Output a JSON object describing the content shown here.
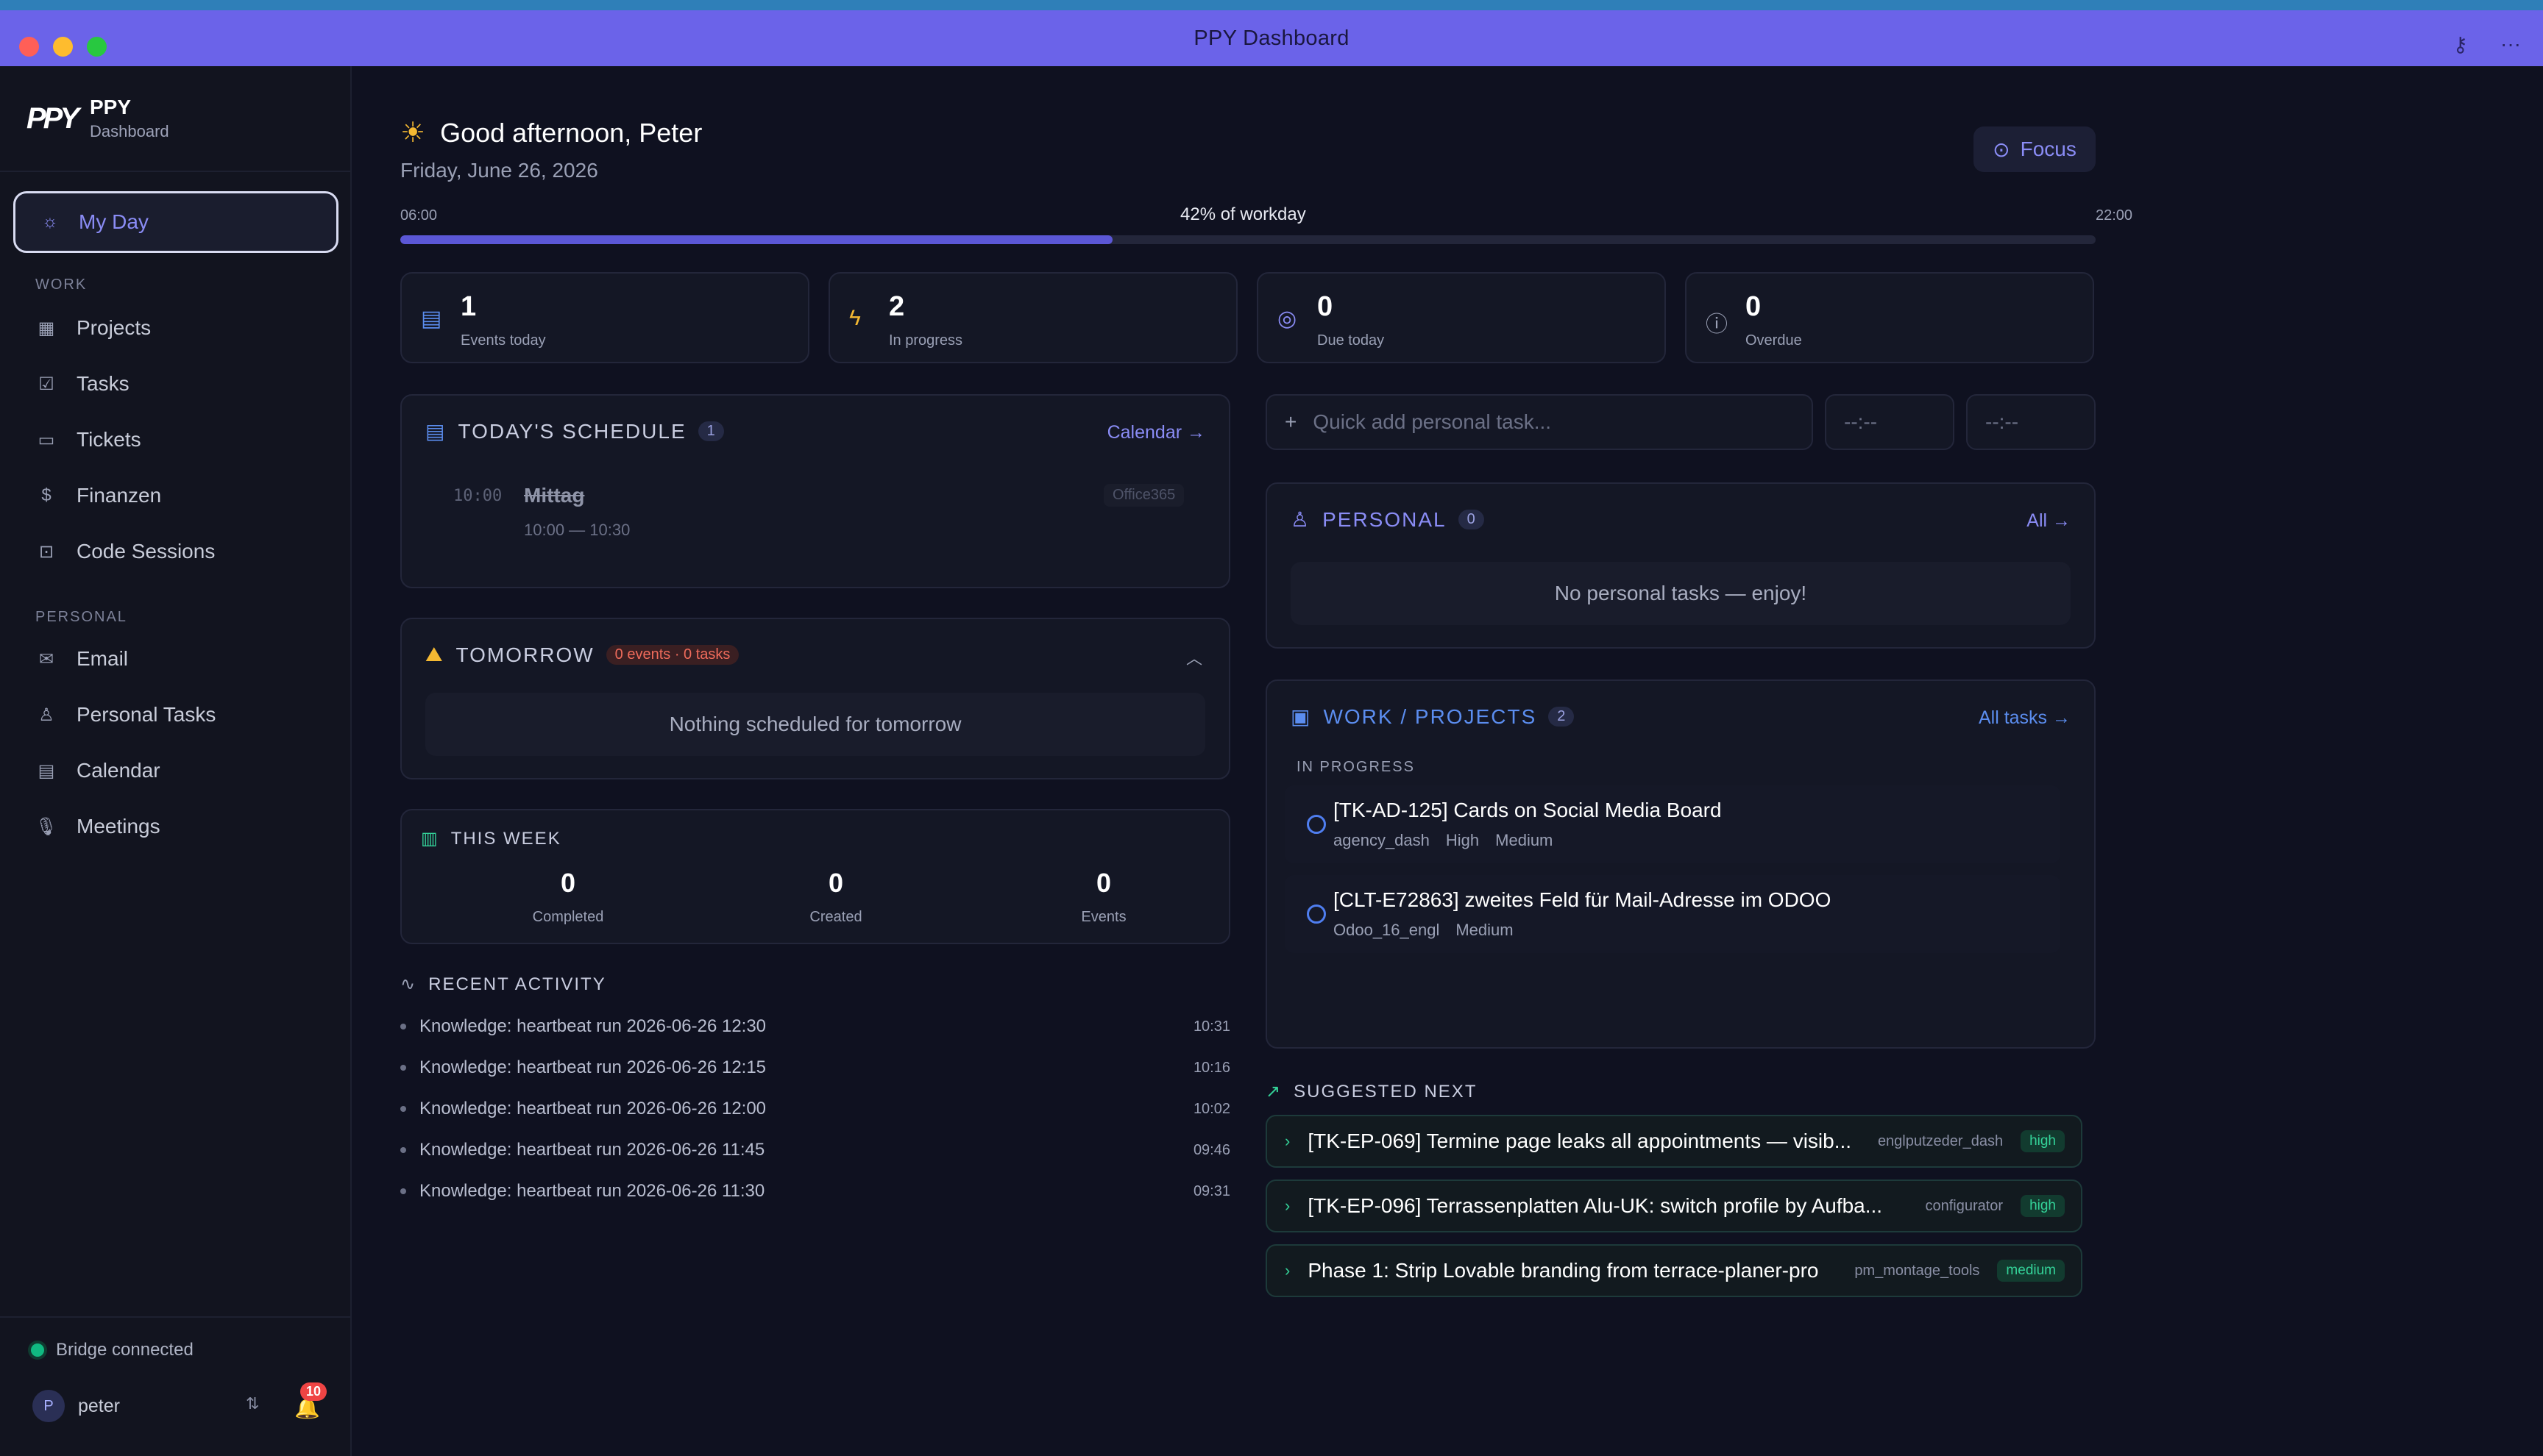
{
  "window": {
    "title": "PPY Dashboard"
  },
  "brand": {
    "logo": "PPY",
    "name": "PPY",
    "subtitle": "Dashboard"
  },
  "sidebar": {
    "active": {
      "label": "My Day",
      "icon": "sun-icon"
    },
    "work_label": "WORK",
    "work_items": [
      {
        "label": "Projects",
        "icon": "grid-icon"
      },
      {
        "label": "Tasks",
        "icon": "checkbox-icon"
      },
      {
        "label": "Tickets",
        "icon": "ticket-icon"
      },
      {
        "label": "Finanzen",
        "icon": "receipt-icon"
      },
      {
        "label": "Code Sessions",
        "icon": "robot-icon"
      }
    ],
    "personal_label": "PERSONAL",
    "personal_items": [
      {
        "label": "Email",
        "icon": "mail-icon"
      },
      {
        "label": "Personal Tasks",
        "icon": "user-icon"
      },
      {
        "label": "Calendar",
        "icon": "calendar-icon"
      },
      {
        "label": "Meetings",
        "icon": "microphone-icon"
      }
    ],
    "bridge_status": "Bridge connected",
    "user": {
      "initial": "P",
      "name": "peter"
    },
    "notification_count": "10"
  },
  "header": {
    "greeting": "Good afternoon, Peter",
    "date": "Friday, June 26, 2026",
    "focus_label": "Focus",
    "workday": {
      "start": "06:00",
      "end": "22:00",
      "label": "42% of workday",
      "fraction": 0.42
    }
  },
  "stats": [
    {
      "value": "1",
      "label": "Events today",
      "icon": "calendar-icon",
      "color": "#5b8def"
    },
    {
      "value": "2",
      "label": "In progress",
      "icon": "bolt-icon",
      "color": "#f5b932"
    },
    {
      "value": "0",
      "label": "Due today",
      "icon": "target-icon",
      "color": "#8a8cf5"
    },
    {
      "value": "0",
      "label": "Overdue",
      "icon": "alert-icon",
      "color": "#9aa0b5"
    }
  ],
  "schedule": {
    "title": "TODAY'S SCHEDULE",
    "count": "1",
    "link": "Calendar →",
    "events": [
      {
        "time": "10:00",
        "title": "Mittag",
        "range": "10:00 — 10:30",
        "source": "Office365"
      }
    ]
  },
  "tomorrow": {
    "title": "TOMORROW",
    "summary": "0 events · 0 tasks",
    "empty": "Nothing scheduled for tomorrow"
  },
  "week": {
    "title": "THIS WEEK",
    "stats": [
      {
        "value": "0",
        "label": "Completed"
      },
      {
        "value": "0",
        "label": "Created"
      },
      {
        "value": "0",
        "label": "Events"
      }
    ]
  },
  "activity": {
    "title": "RECENT ACTIVITY",
    "items": [
      {
        "text": "Knowledge: heartbeat run 2026-06-26 12:30",
        "time": "10:31"
      },
      {
        "text": "Knowledge: heartbeat run 2026-06-26 12:15",
        "time": "10:16"
      },
      {
        "text": "Knowledge: heartbeat run 2026-06-26 12:00",
        "time": "10:02"
      },
      {
        "text": "Knowledge: heartbeat run 2026-06-26 11:45",
        "time": "09:46"
      },
      {
        "text": "Knowledge: heartbeat run 2026-06-26 11:30",
        "time": "09:31"
      }
    ]
  },
  "quick_add": {
    "placeholder": "Quick add personal task...",
    "time1": "--:--",
    "time2": "--:--"
  },
  "personal": {
    "title": "PERSONAL",
    "count": "0",
    "link": "All →",
    "empty": "No personal tasks — enjoy!"
  },
  "work": {
    "title": "WORK / PROJECTS",
    "count": "2",
    "link": "All tasks →",
    "section": "IN PROGRESS",
    "tasks": [
      {
        "title": "[TK-AD-125] Cards on Social Media Board",
        "meta": [
          "agency_dash",
          "High",
          "Medium"
        ]
      },
      {
        "title": "[CLT-E72863] zweites Feld für Mail-Adresse im ODOO",
        "meta": [
          "Odoo_16_engl",
          "Medium"
        ]
      }
    ]
  },
  "suggested": {
    "title": "SUGGESTED NEXT",
    "items": [
      {
        "title": "[TK-EP-069] Termine page leaks all appointments — visib...",
        "project": "englputzeder_dash",
        "priority": "high"
      },
      {
        "title": "[TK-EP-096] Terrassenplatten Alu-UK: switch profile by Aufba...",
        "project": "configurator",
        "priority": "high"
      },
      {
        "title": "Phase 1: Strip Lovable branding from terrace-planer-pro",
        "project": "pm_montage_tools",
        "priority": "medium"
      }
    ]
  }
}
